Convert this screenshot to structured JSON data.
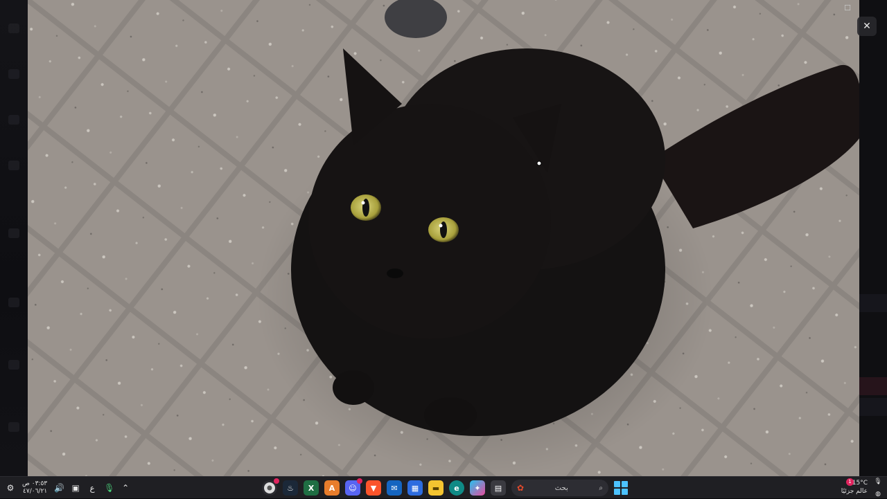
{
  "viewer": {
    "close_symbol": "✕",
    "maximize_symbol": "☐"
  },
  "taskbar": {
    "clock": {
      "time": "٠٣:٥٣ ص",
      "date": "٤٧/٠٦/٢١"
    },
    "language": "ع",
    "search": {
      "placeholder": "بحث"
    },
    "weather": {
      "temp": "15°C",
      "text": "عالم جزئيًا",
      "badge": "1"
    },
    "apps": [
      {
        "name": "chrome-app",
        "label": ""
      },
      {
        "name": "steam-app",
        "label": ""
      },
      {
        "name": "excel-app",
        "label": "X"
      },
      {
        "name": "app-a",
        "label": "A"
      },
      {
        "name": "discord-app",
        "label": ""
      },
      {
        "name": "brave-app",
        "label": ""
      },
      {
        "name": "mail-app",
        "label": ""
      },
      {
        "name": "store-app",
        "label": ""
      },
      {
        "name": "files-app",
        "label": ""
      },
      {
        "name": "edge-app",
        "label": ""
      },
      {
        "name": "copilot-app",
        "label": ""
      },
      {
        "name": "window-app",
        "label": ""
      }
    ],
    "colors": {
      "bar": "#1f1f23",
      "start": "#4cc2ff",
      "badge": "#e0245e"
    }
  }
}
